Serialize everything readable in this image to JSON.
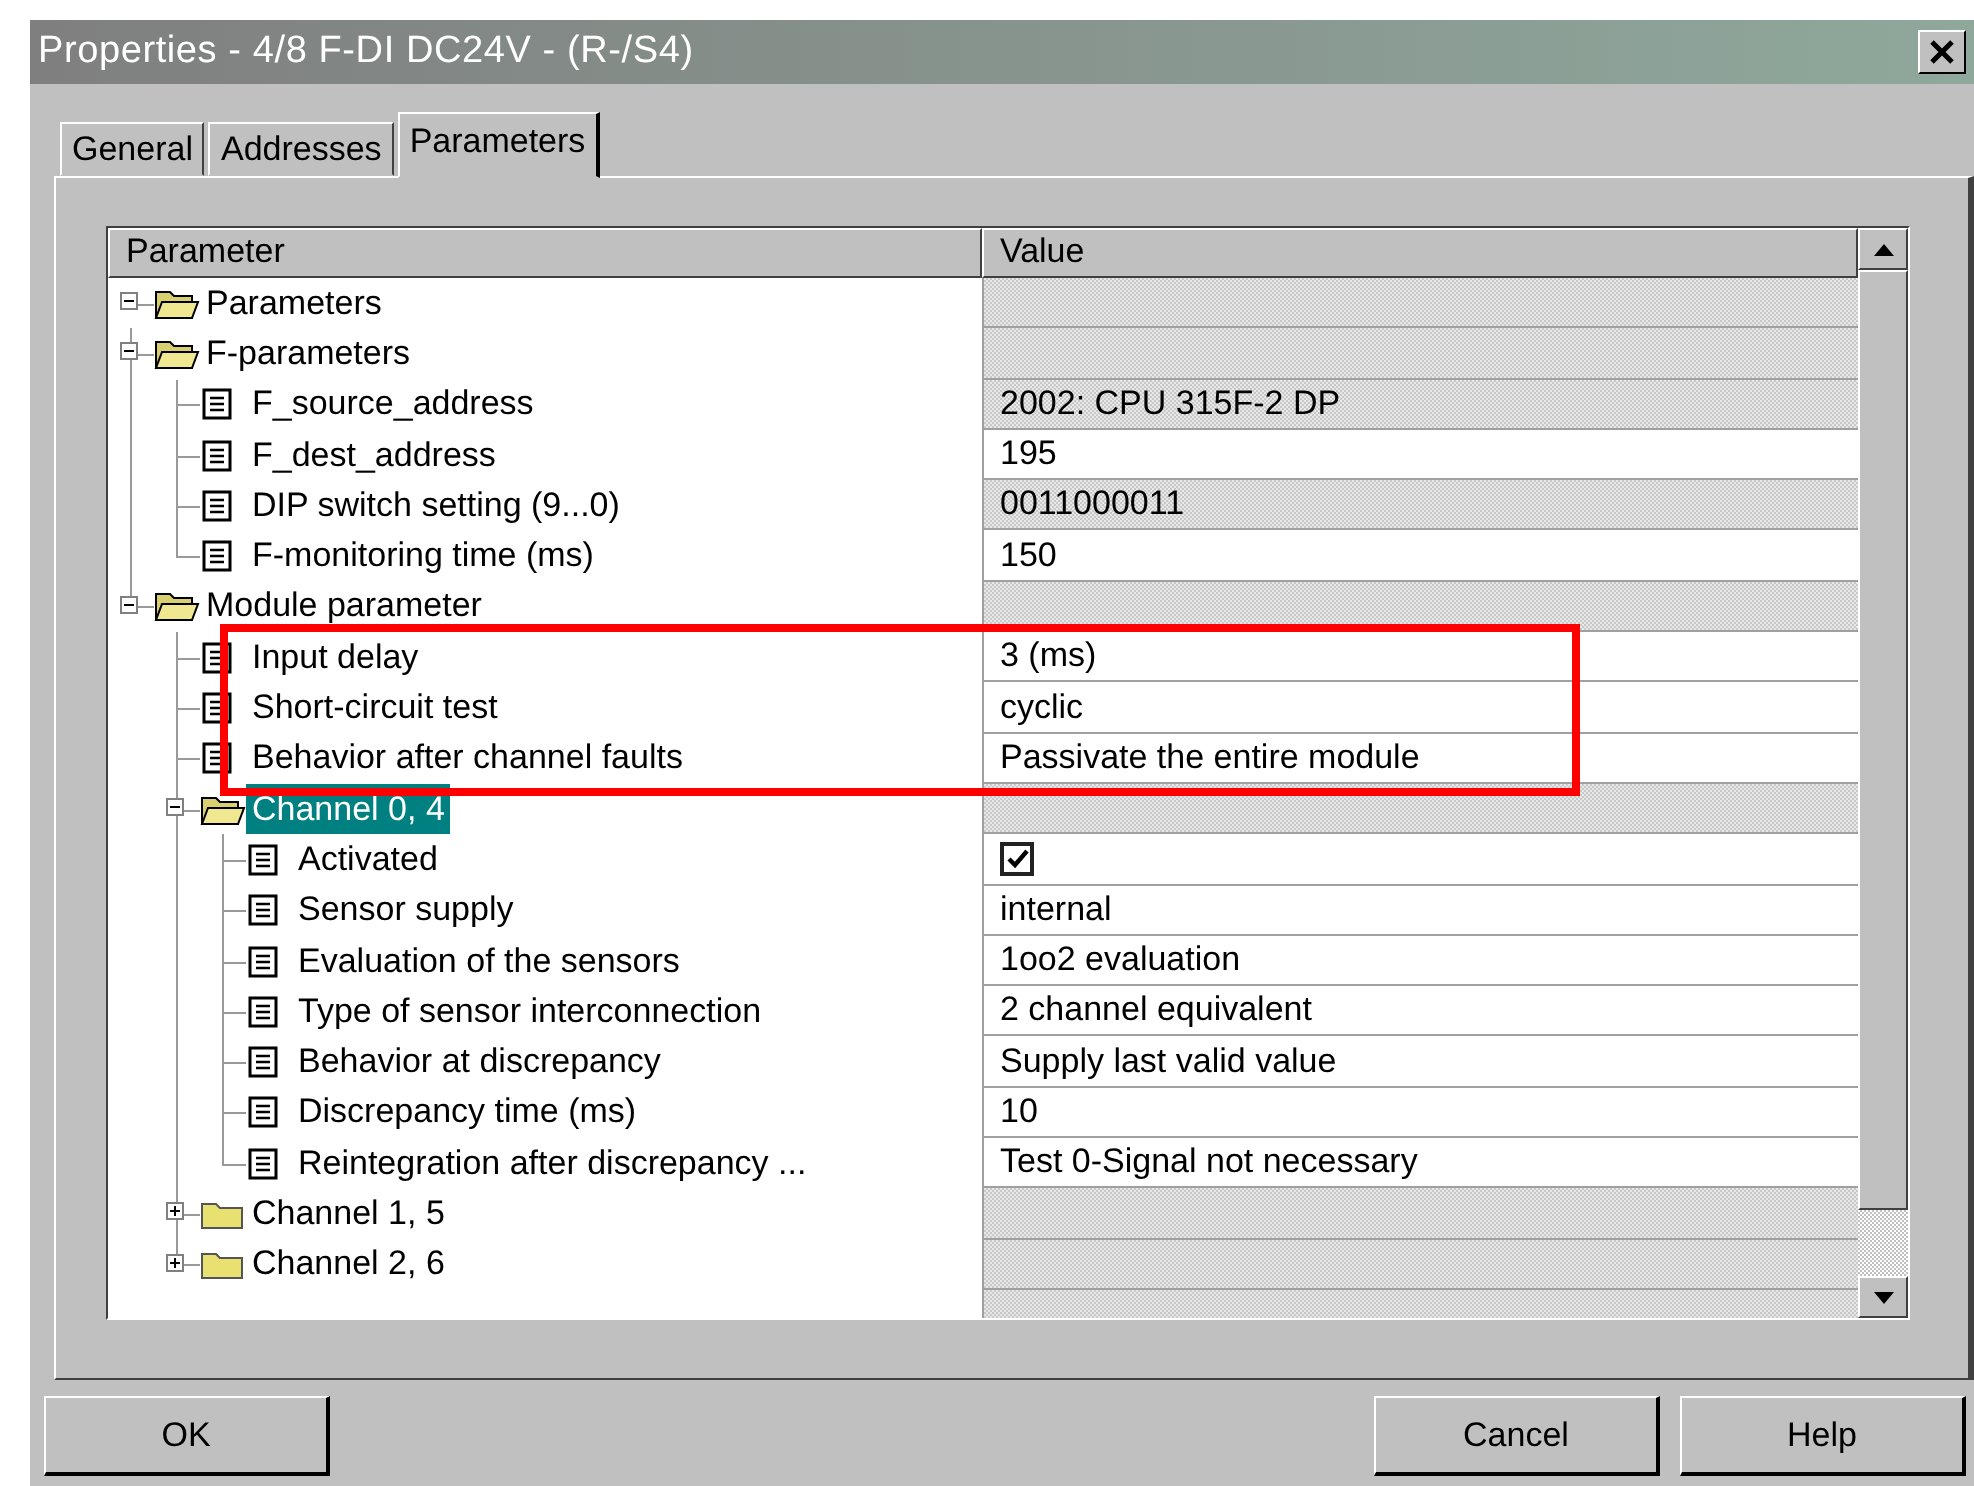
{
  "window": {
    "title": "Properties - 4/8 F-DI DC24V - (R-/S4)"
  },
  "tabs": [
    {
      "label": "General",
      "selected": false
    },
    {
      "label": "Addresses",
      "selected": false
    },
    {
      "label": "Parameters",
      "selected": true
    }
  ],
  "table": {
    "columns": [
      "Parameter",
      "Value"
    ],
    "rows": [
      {
        "kind": "folder",
        "label": "Parameters",
        "expanded": true,
        "selected": false,
        "children": [
          {
            "kind": "folder",
            "label": "F-parameters",
            "expanded": true,
            "selected": false,
            "children": [
              {
                "kind": "item",
                "label": "F_source_address",
                "value": "2002: CPU 315F-2 DP",
                "read_only": true,
                "selected": false
              },
              {
                "kind": "item",
                "label": "F_dest_address",
                "value": "195",
                "read_only": false,
                "selected": false
              },
              {
                "kind": "item",
                "label": "DIP switch setting (9...0)",
                "value": "0011000011",
                "read_only": true,
                "selected": false
              },
              {
                "kind": "item",
                "label": "F-monitoring time (ms)",
                "value": "150",
                "read_only": false,
                "selected": false
              }
            ]
          },
          {
            "kind": "folder",
            "label": "Module parameter",
            "expanded": true,
            "selected": false,
            "children": [
              {
                "kind": "item",
                "label": "Input delay",
                "value": "3 (ms)",
                "read_only": false,
                "selected": false,
                "highlighted": true
              },
              {
                "kind": "item",
                "label": "Short-circuit test",
                "value": "cyclic",
                "read_only": false,
                "selected": false,
                "highlighted": true
              },
              {
                "kind": "item",
                "label": "Behavior after channel faults",
                "value": "Passivate the entire module",
                "read_only": false,
                "selected": false,
                "highlighted": true
              },
              {
                "kind": "folder",
                "label": "Channel 0, 4",
                "expanded": true,
                "selected": true,
                "children": [
                  {
                    "kind": "checkbox",
                    "label": "Activated",
                    "checked": true,
                    "read_only": false,
                    "selected": false
                  },
                  {
                    "kind": "item",
                    "label": "Sensor supply",
                    "value": "internal",
                    "read_only": false,
                    "selected": false
                  },
                  {
                    "kind": "item",
                    "label": "Evaluation of the sensors",
                    "value": "1oo2 evaluation",
                    "read_only": false,
                    "selected": false
                  },
                  {
                    "kind": "item",
                    "label": "Type of sensor interconnection",
                    "value": "2 channel equivalent",
                    "read_only": false,
                    "selected": false
                  },
                  {
                    "kind": "item",
                    "label": "Behavior at discrepancy",
                    "value": "Supply last valid value",
                    "read_only": false,
                    "selected": false
                  },
                  {
                    "kind": "item",
                    "label": "Discrepancy time (ms)",
                    "value": "10",
                    "read_only": false,
                    "selected": false
                  },
                  {
                    "kind": "item",
                    "label": "Reintegration after discrepancy ...",
                    "value": "Test 0-Signal not necessary",
                    "read_only": false,
                    "selected": false
                  }
                ]
              },
              {
                "kind": "folder",
                "label": "Channel 1, 5",
                "expanded": false,
                "selected": false
              },
              {
                "kind": "folder",
                "label": "Channel 2, 6",
                "expanded": false,
                "selected": false
              }
            ]
          }
        ]
      }
    ]
  },
  "buttons": [
    {
      "label": "OK"
    },
    {
      "label": "Cancel"
    },
    {
      "label": "Help"
    }
  ]
}
